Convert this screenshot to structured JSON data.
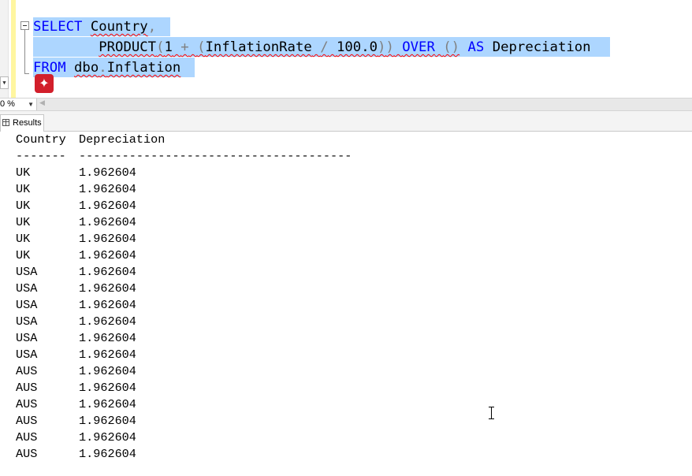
{
  "editor": {
    "line1": {
      "select_kw": "SELECT",
      "country": "Country",
      "comma": ","
    },
    "line2": {
      "product": "PRODUCT",
      "open1": "(",
      "one": "1",
      "plus": "+",
      "open2": "(",
      "inflation": "InflationRate",
      "slash": "/",
      "hundred": "100.0",
      "close2": ")",
      "close1": ")",
      "over": "OVER",
      "parens": "()",
      "as": "AS",
      "depreciation": "Depreciation"
    },
    "line3": {
      "from_kw": "FROM",
      "schema": "dbo",
      "dot": ".",
      "table": "Inflation"
    }
  },
  "status": {
    "zoom": "0 %"
  },
  "tabs": [
    {
      "label": "Results"
    }
  ],
  "results": {
    "headers": [
      "Country",
      "Depreciation"
    ],
    "separator": [
      "-------",
      "--------------------------------------"
    ],
    "rows": [
      [
        "UK",
        "1.962604"
      ],
      [
        "UK",
        "1.962604"
      ],
      [
        "UK",
        "1.962604"
      ],
      [
        "UK",
        "1.962604"
      ],
      [
        "UK",
        "1.962604"
      ],
      [
        "UK",
        "1.962604"
      ],
      [
        "USA",
        "1.962604"
      ],
      [
        "USA",
        "1.962604"
      ],
      [
        "USA",
        "1.962604"
      ],
      [
        "USA",
        "1.962604"
      ],
      [
        "USA",
        "1.962604"
      ],
      [
        "USA",
        "1.962604"
      ],
      [
        "AUS",
        "1.962604"
      ],
      [
        "AUS",
        "1.962604"
      ],
      [
        "AUS",
        "1.962604"
      ],
      [
        "AUS",
        "1.962604"
      ],
      [
        "AUS",
        "1.962604"
      ],
      [
        "AUS",
        "1.962604"
      ]
    ]
  },
  "colors": {
    "selection": "#add6ff",
    "keyword": "#0000ff",
    "operator": "#808080",
    "error_badge": "#d21f2b"
  }
}
